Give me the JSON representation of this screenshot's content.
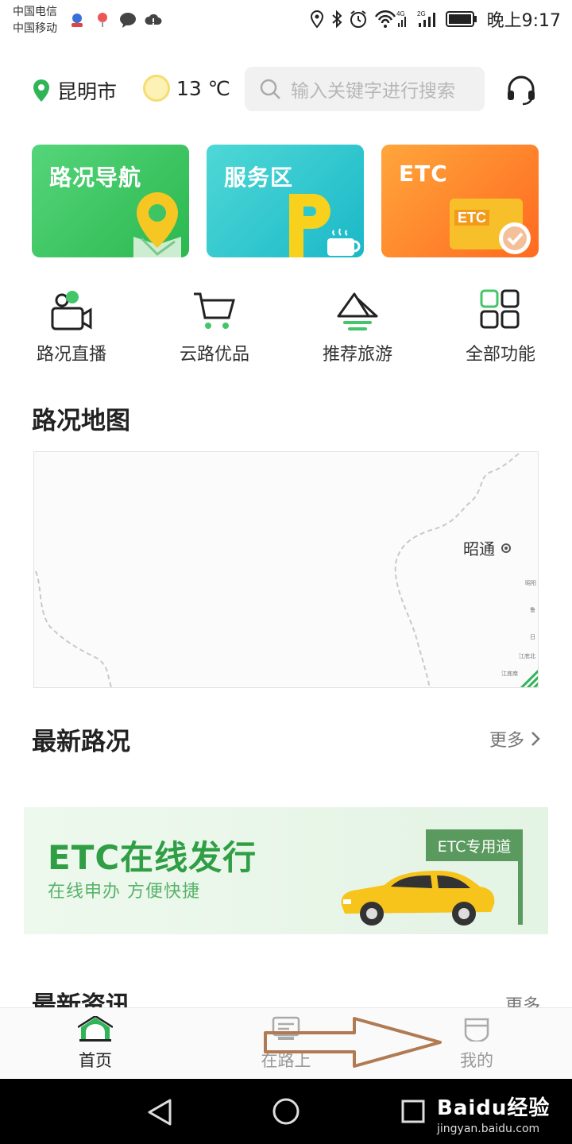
{
  "status_bar": {
    "carrier_1": "中国电信",
    "carrier_2": "中国移动",
    "network_1": "4G",
    "network_2": "2G",
    "time": "晚上9:17"
  },
  "header": {
    "city": "昆明市",
    "temperature": "13 ℃",
    "search_placeholder": "输入关键字进行搜索"
  },
  "feature_cards": [
    {
      "label": "路况导航",
      "color": "#3cc465"
    },
    {
      "label": "服务区",
      "color": "#2cc8cf"
    },
    {
      "label": "ETC",
      "color": "#ff8a2e",
      "card_text": "ETC"
    }
  ],
  "quick_links": [
    {
      "label": "路况直播",
      "icon": "camera-icon"
    },
    {
      "label": "云路优品",
      "icon": "cart-icon"
    },
    {
      "label": "推荐旅游",
      "icon": "mountain-icon"
    },
    {
      "label": "全部功能",
      "icon": "grid-icon"
    }
  ],
  "map_section": {
    "title": "路况地图",
    "city_label": "昭通",
    "small_labels": [
      "昭阳",
      "鲁",
      "日",
      "江底北",
      "江底南"
    ]
  },
  "latest_traffic": {
    "title": "最新路况",
    "more": "更多"
  },
  "etc_banner": {
    "title": "ETC在线发行",
    "subtitle": "在线申办 方便快捷",
    "lane_sign": "ETC专用道"
  },
  "latest_news": {
    "title": "最新资讯",
    "more": "更多"
  },
  "tab_bar": [
    {
      "label": "首页",
      "active": true
    },
    {
      "label": "在路上",
      "active": false
    },
    {
      "label": "我的",
      "active": false
    }
  ],
  "watermark": {
    "brand": "Baidu经验",
    "url": "jingyan.baidu.com"
  },
  "colors": {
    "brand_green": "#2f9e44",
    "accent_orange": "#ff8a2e",
    "arrow_brown": "#b07a52"
  }
}
